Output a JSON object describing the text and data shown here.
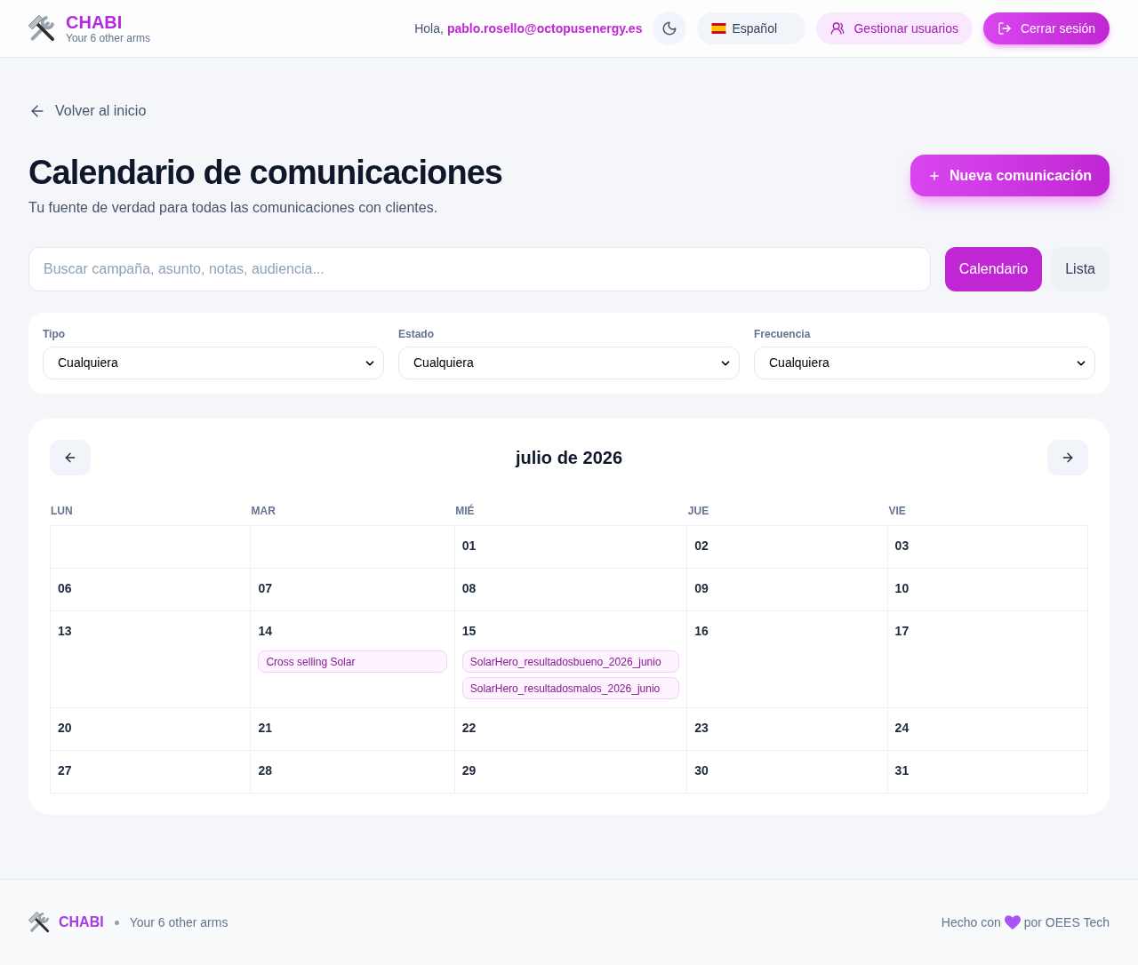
{
  "header": {
    "brand": "CHABI",
    "tagline": "Your 6 other arms",
    "greeting": "Hola,",
    "user_email": "pablo.rosello@octopusenergy.es",
    "language": "Español",
    "manage_users": "Gestionar usuarios",
    "logout": "Cerrar sesión"
  },
  "back_link": "Volver al inicio",
  "page": {
    "title": "Calendario de comunicaciones",
    "subtitle": "Tu fuente de verdad para todas las comunicaciones con clientes.",
    "new_button": "Nueva comunicación"
  },
  "search": {
    "placeholder": "Buscar campaña, asunto, notas, audiencia..."
  },
  "views": [
    {
      "label": "Calendario",
      "selected": true
    },
    {
      "label": "Lista",
      "selected": false
    }
  ],
  "filters": [
    {
      "label": "Tipo",
      "value": "Cualquiera"
    },
    {
      "label": "Estado",
      "value": "Cualquiera"
    },
    {
      "label": "Frecuencia",
      "value": "Cualquiera"
    }
  ],
  "calendar": {
    "title": "julio de 2026",
    "weekdays": [
      "LUN",
      "MAR",
      "MIÉ",
      "JUE",
      "VIE"
    ],
    "weeks": [
      [
        {
          "day": "01"
        },
        {
          "day": "02"
        },
        {
          "day": "03"
        }
      ],
      [
        {
          "day": "06"
        },
        {
          "day": "07"
        },
        {
          "day": "08"
        },
        {
          "day": "09"
        },
        {
          "day": "10"
        }
      ],
      [
        {
          "day": "13"
        },
        {
          "day": "14",
          "events": [
            "Cross selling Solar"
          ]
        },
        {
          "day": "15",
          "events": [
            "SolarHero_resultadosbueno_2026_junio",
            "SolarHero_resultadosmalos_2026_junio"
          ]
        },
        {
          "day": "16"
        },
        {
          "day": "17"
        }
      ],
      [
        {
          "day": "20"
        },
        {
          "day": "21"
        },
        {
          "day": "22"
        },
        {
          "day": "23"
        },
        {
          "day": "24"
        }
      ],
      [
        {
          "day": "27"
        },
        {
          "day": "28"
        },
        {
          "day": "29"
        },
        {
          "day": "30"
        },
        {
          "day": "31"
        }
      ]
    ]
  },
  "footer": {
    "brand": "CHABI",
    "tagline": "Your 6 other arms",
    "credit_prefix": "Hecho con",
    "credit_suffix": "por OEES Tech"
  }
}
